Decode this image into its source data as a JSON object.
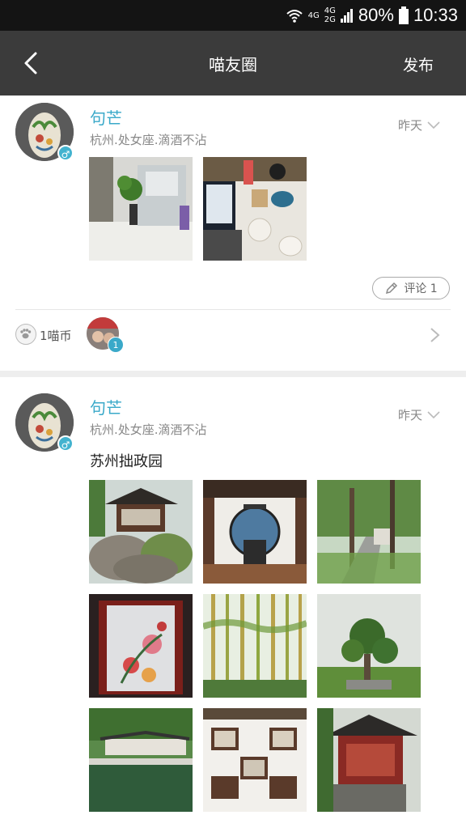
{
  "statusbar": {
    "net1": "4G",
    "net2a": "4G",
    "net2b": "2G",
    "battery": "80%",
    "time": "10:33"
  },
  "navbar": {
    "title": "喵友圈",
    "publish": "发布"
  },
  "posts": [
    {
      "username": "句芒",
      "bio": "杭州.处女座.滴酒不沾",
      "time": "昨天",
      "gender": "♂",
      "photos": [
        "office-plant-photo",
        "desk-laptop-photo"
      ],
      "comment_label": "评论 1",
      "reward_label": "1喵币",
      "reward_count": "1"
    },
    {
      "username": "句芒",
      "bio": "杭州.处女座.滴酒不沾",
      "time": "昨天",
      "gender": "♂",
      "text": "苏州拙政园",
      "photos": [
        "pavilion-rockery-photo",
        "moon-gate-hall-photo",
        "garden-path-photo",
        "peony-screen-photo",
        "bamboo-grove-photo",
        "bonsai-tree-photo",
        "pond-corridor-photo",
        "painting-exhibit-photo",
        "red-pavilion-photo"
      ]
    }
  ],
  "colors": {
    "accent": "#3aa9c9",
    "navbar": "#3b3b3b",
    "statusbar": "#141414"
  }
}
